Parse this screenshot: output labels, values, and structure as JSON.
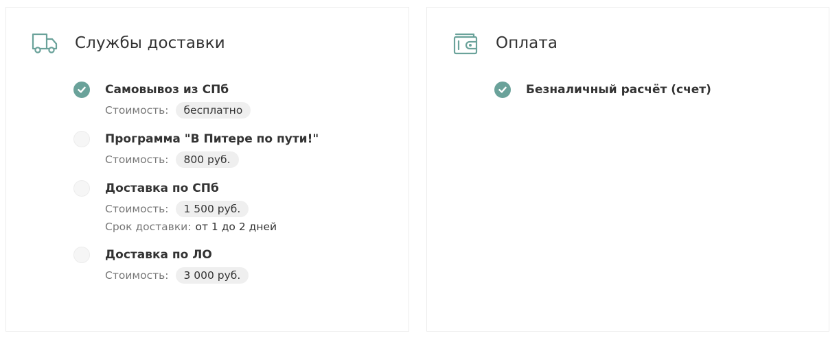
{
  "delivery": {
    "title": "Службы доставки",
    "icon": "truck-icon",
    "options": [
      {
        "title": "Самовывоз из СПб",
        "selected": true,
        "cost_label": "Стоимость:",
        "cost": "бесплатно"
      },
      {
        "title": "Программа \"В Питере по пути!\"",
        "selected": false,
        "cost_label": "Стоимость:",
        "cost": "800 руб."
      },
      {
        "title": "Доставка по СПб",
        "selected": false,
        "cost_label": "Стоимость:",
        "cost": "1 500 руб.",
        "term_label": "Срок доставки:",
        "term": "от 1 до 2 дней"
      },
      {
        "title": "Доставка по ЛО",
        "selected": false,
        "cost_label": "Стоимость:",
        "cost": "3 000 руб."
      }
    ]
  },
  "payment": {
    "title": "Оплата",
    "icon": "wallet-icon",
    "options": [
      {
        "title": "Безналичный расчёт (счет)",
        "selected": true
      }
    ]
  },
  "colors": {
    "accent": "#6aa29a",
    "text": "#333333",
    "muted": "#777777",
    "pill_bg": "#efefef",
    "border": "#ececec"
  }
}
